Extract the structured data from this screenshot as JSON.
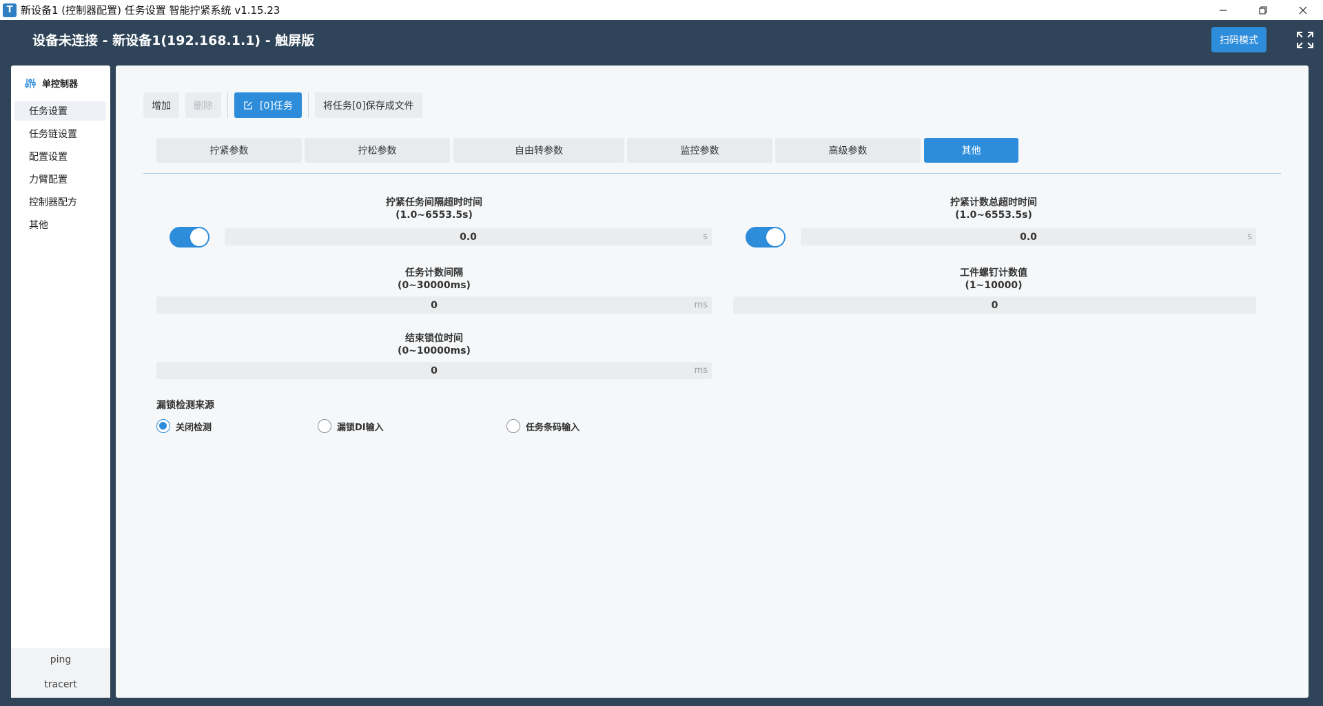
{
  "window": {
    "title": "新设备1 (控制器配置) 任务设置 智能拧紧系统 v1.15.23",
    "icon_name": "app-logo-icon",
    "controls": [
      "minimize-icon",
      "restore-icon",
      "close-icon"
    ]
  },
  "header": {
    "title": "设备未连接 - 新设备1(192.168.1.1) - 触屏版",
    "scan_button": "扫码模式",
    "fullscreen_icon": "fullscreen-icon"
  },
  "sidebar": {
    "heading": "单控制器",
    "heading_icon": "sliders-icon",
    "items": [
      {
        "label": "任务设置",
        "active": true
      },
      {
        "label": "任务链设置"
      },
      {
        "label": "配置设置"
      },
      {
        "label": "力臂配置"
      },
      {
        "label": "控制器配方"
      },
      {
        "label": "其他"
      }
    ],
    "footer": [
      "ping",
      "tracert"
    ]
  },
  "toolbar": {
    "add": "增加",
    "delete": "删除",
    "task": "[0]任务",
    "save_to_file": "将任务[0]保存成文件"
  },
  "tabs": [
    "拧紧参数",
    "拧松参数",
    "自由转参数",
    "监控参数",
    "高级参数",
    "其他"
  ],
  "active_tab": "其他",
  "fields": {
    "tighten_interval_timeout": {
      "label": "拧紧任务间隔超时时间",
      "range": "(1.0~6553.5s)",
      "value": "0.0",
      "unit": "s",
      "enabled": true
    },
    "tighten_count_timeout": {
      "label": "拧紧计数总超时时间",
      "range": "(1.0~6553.5s)",
      "value": "0.0",
      "unit": "s",
      "enabled": true
    },
    "task_count_interval": {
      "label": "任务计数间隔",
      "range": "(0~30000ms)",
      "value": "0",
      "unit": "ms"
    },
    "screw_count": {
      "label": "工件螺钉计数值",
      "range": "(1~10000)",
      "value": "0"
    },
    "end_lock_time": {
      "label": "结束锁位时间",
      "range": "(0~10000ms)",
      "value": "0",
      "unit": "ms"
    }
  },
  "leak_detection": {
    "title": "漏锁检测来源",
    "options": [
      "关闭检测",
      "漏锁DI输入",
      "任务条码输入"
    ],
    "selected": "关闭检测"
  },
  "colors": {
    "accent": "#2e8ddb",
    "header_bg": "#2f4458"
  }
}
